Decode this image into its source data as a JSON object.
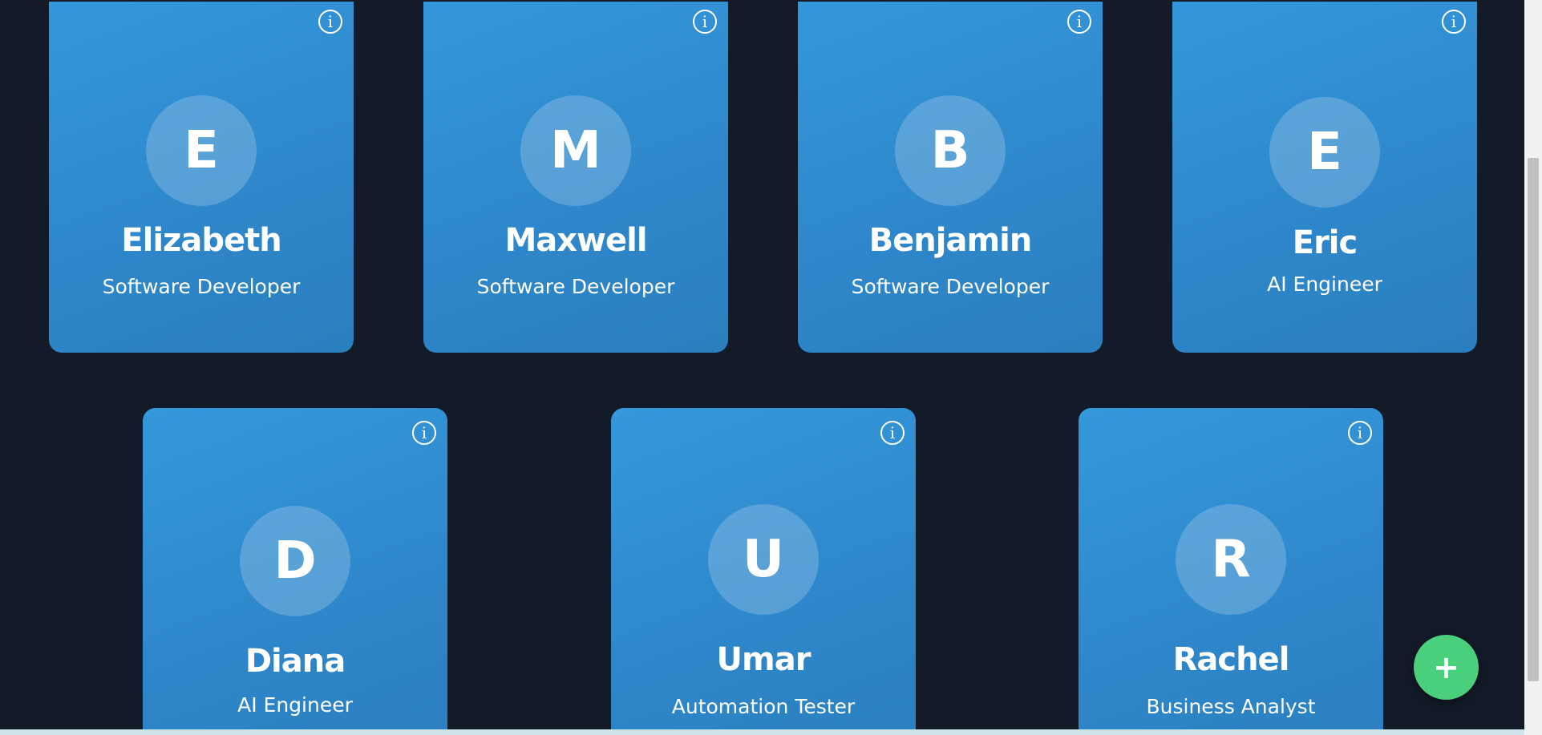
{
  "cards": [
    {
      "initial": "E",
      "name": "Elizabeth",
      "role": "Software Developer",
      "info_icon": "i"
    },
    {
      "initial": "M",
      "name": "Maxwell",
      "role": "Software Developer",
      "info_icon": "i"
    },
    {
      "initial": "B",
      "name": "Benjamin",
      "role": "Software Developer",
      "info_icon": "i"
    },
    {
      "initial": "E",
      "name": "Eric",
      "role": "AI Engineer",
      "info_icon": "i"
    },
    {
      "initial": "D",
      "name": "Diana",
      "role": "AI Engineer",
      "info_icon": "i"
    },
    {
      "initial": "U",
      "name": "Umar",
      "role": "Automation Tester",
      "info_icon": "i"
    },
    {
      "initial": "R",
      "name": "Rachel",
      "role": "Business Analyst",
      "info_icon": "i"
    }
  ],
  "fab": {
    "label": "+",
    "icon": "plus-icon"
  },
  "colors": {
    "background": "#131a28",
    "card": "#3498db",
    "fab": "#4ad07c",
    "text": "#ffffff"
  }
}
